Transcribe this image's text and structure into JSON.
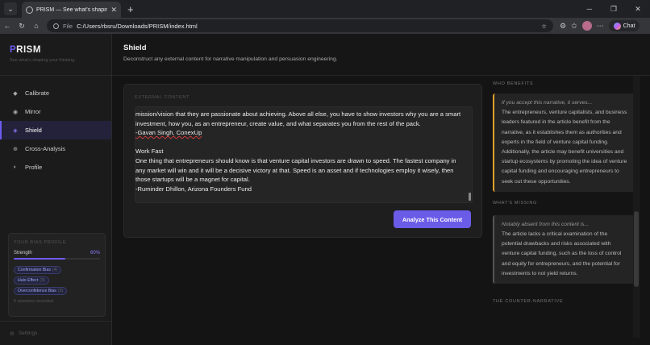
{
  "browser": {
    "tab_title": "PRISM — See what's shaping your",
    "address_prefix": "File",
    "url": "C:/Users/rbsru/Downloads/PRISM/index.html",
    "chat_label": "Chat"
  },
  "sidebar": {
    "logo_first": "P",
    "logo_rest": "RISM",
    "tagline": "See what's shaping your thinking.",
    "items": [
      {
        "label": "Calibrate",
        "icon": "diamond-icon"
      },
      {
        "label": "Mirror",
        "icon": "circle-icon"
      },
      {
        "label": "Shield",
        "icon": "shield-icon"
      },
      {
        "label": "Cross-Analysis",
        "icon": "crosshair-icon"
      },
      {
        "label": "Profile",
        "icon": "half-circle-icon"
      }
    ],
    "active_item": "Shield",
    "bias_profile": {
      "heading": "YOUR BIAS PROFILE",
      "strength_label": "Strength",
      "strength_value": "60%",
      "strength_fraction": 0.6,
      "chips": [
        {
          "label": "Confirmation Bias",
          "count": "(4)"
        },
        {
          "label": "Halo Effect",
          "count": "(3)"
        },
        {
          "label": "Overconfidence Bias",
          "count": "(3)"
        }
      ],
      "sessions": "5 sessions recorded"
    },
    "settings_label": "Settings"
  },
  "main": {
    "title": "Shield",
    "subtitle": "Deconstruct any external content for narrative manipulation and persuasion engineering.",
    "card_heading": "EXTERNAL CONTENT",
    "content_lines": [
      "mission/vision that they are passionate about achieving. Above all else, you have to show investors why you are a smart investment, how you, as an entrepreneur, create value, and what separates you from the rest of the pack.",
      "-Gavan Singh, ConexUp",
      "",
      "Work Fast",
      "One thing that entrepreneurs should know is that venture capital investors are drawn to speed. The fastest company in any market will win and it will be a decisive victory at that. Speed is an asset and if technologies employ it wisely, then those startups will be a magnet for capital.",
      "-Ruminder Dhillon, Arizona Founders Fund"
    ],
    "analyze_label": "Analyze This Content"
  },
  "analysis": {
    "who_benefits_heading": "WHO BENEFITS",
    "who_benefits_lead": "If you accept this narrative, it serves...",
    "who_benefits_text": "The entrepreneurs, venture capitalists, and business leaders featured in the article benefit from the narrative, as it establishes them as authorities and experts in the field of venture capital funding. Additionally, the article may benefit universities and startup ecosystems by promoting the idea of venture capital funding and encouraging entrepreneurs to seek out these opportunities.",
    "missing_heading": "WHAT'S MISSING",
    "missing_lead": "Notably absent from this content is...",
    "missing_text": "The article lacks a critical examination of the potential drawbacks and risks associated with venture capital funding, such as the loss of control and equity for entrepreneurs, and the potential for investments to not yield returns.",
    "counter_heading": "THE COUNTER-NARRATIVE"
  },
  "colors": {
    "accent": "#6d5cf0",
    "benefit_border": "#e0a12c",
    "background": "#141414"
  }
}
